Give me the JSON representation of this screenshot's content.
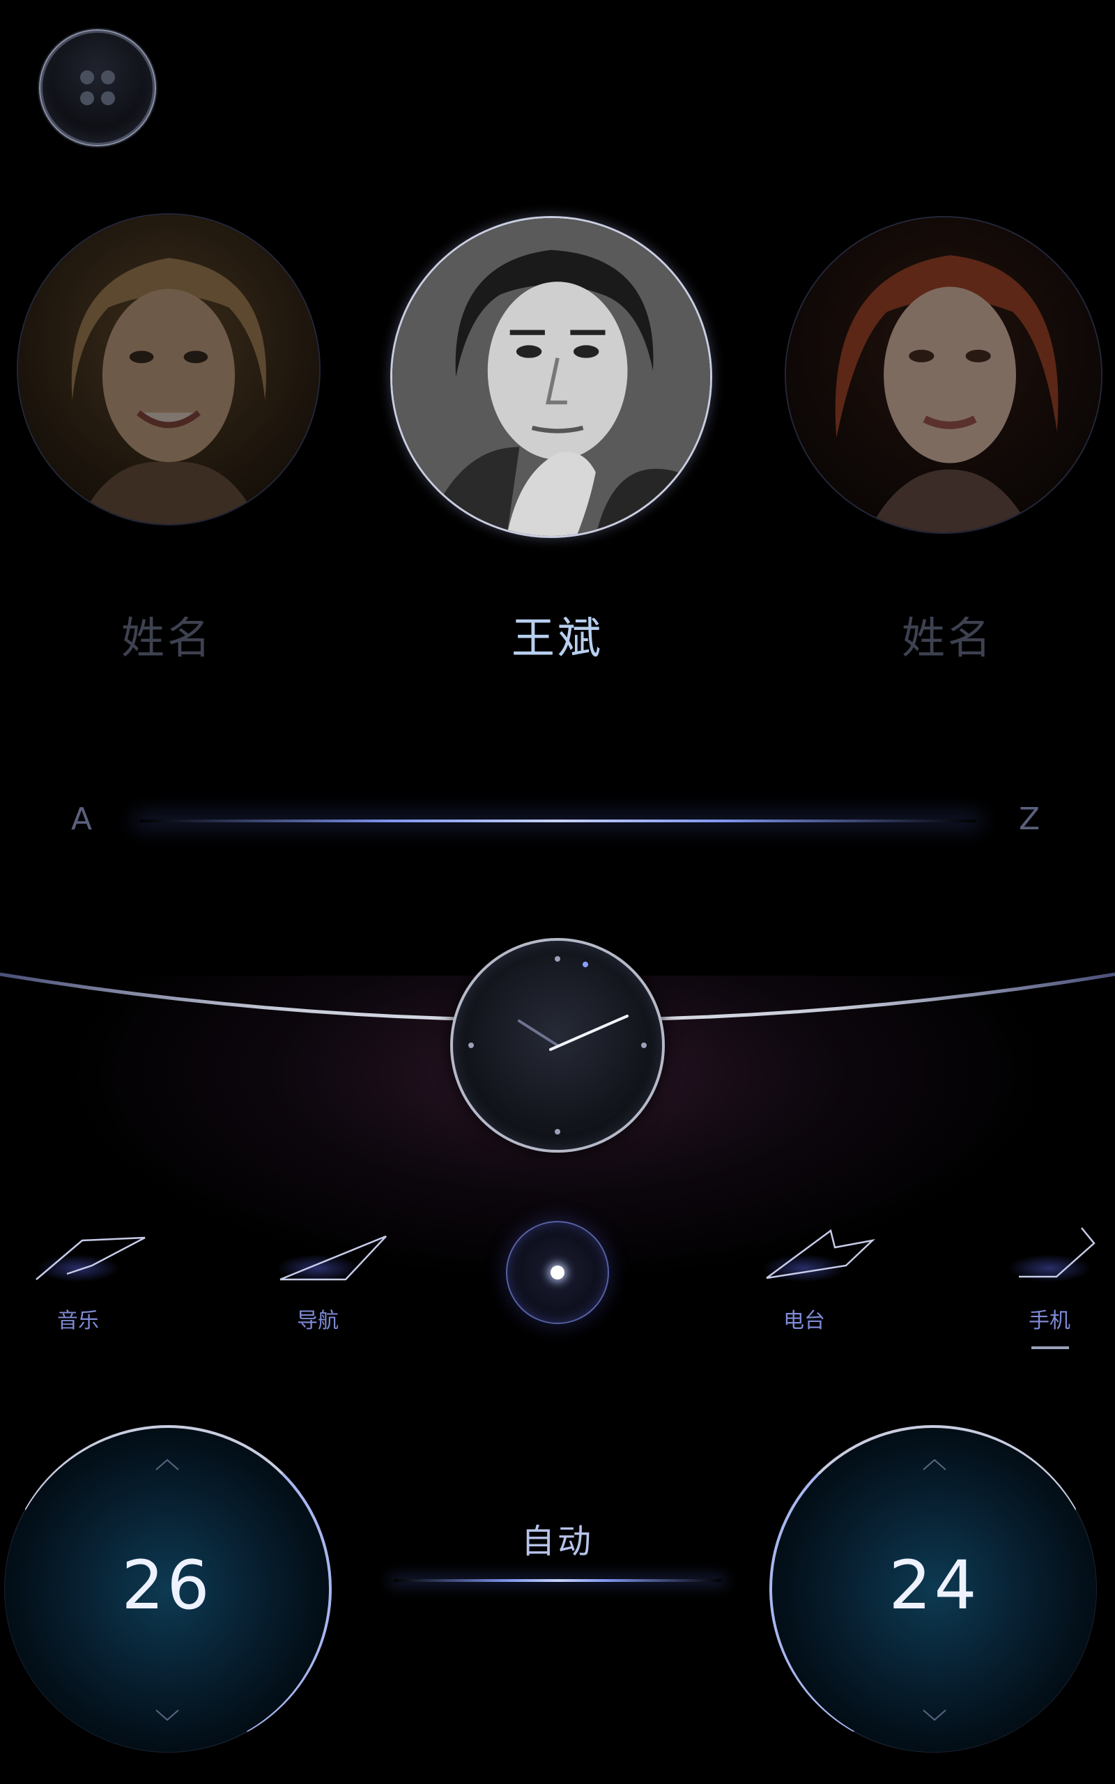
{
  "menu": {
    "icon": "four-dots-icon"
  },
  "contacts": [
    {
      "name": "姓名",
      "state": "inactive"
    },
    {
      "name": "王斌",
      "state": "selected"
    },
    {
      "name": "姓名",
      "state": "inactive"
    }
  ],
  "alphabet": {
    "start": "A",
    "end": "Z"
  },
  "apps": [
    {
      "label": "音乐",
      "icon": "music-icon"
    },
    {
      "label": "导航",
      "icon": "navigation-icon"
    },
    {
      "label": "电台",
      "icon": "radio-icon"
    },
    {
      "label": "手机",
      "icon": "phone-icon",
      "active": true
    }
  ],
  "climate": {
    "left_temp": "26",
    "right_temp": "24",
    "mode": "自动"
  },
  "colors": {
    "accent": "#7f95ee",
    "selected_name": "#b8d0ef",
    "inactive_name": "#3d4150",
    "app_label": "#7f8ad6"
  }
}
